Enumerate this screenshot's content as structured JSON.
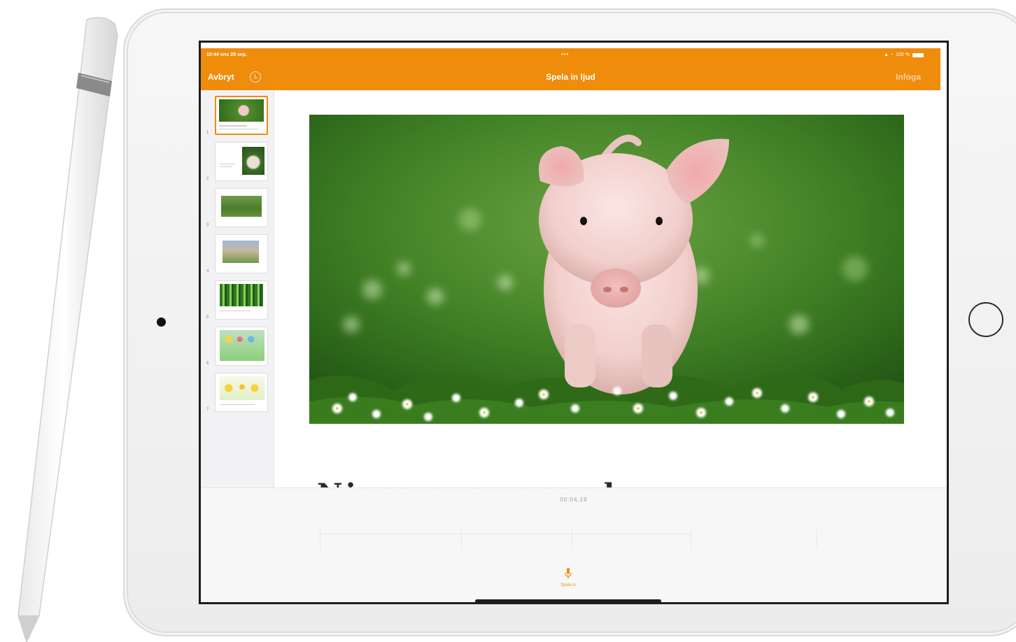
{
  "status_bar": {
    "time": "10:44  ons 29 sep.",
    "dots": "•••",
    "battery": "100 %"
  },
  "nav": {
    "cancel_label": "Avbryt",
    "title": "Spela in ljud",
    "insert_label": "Infoga"
  },
  "slides": {
    "numbers": [
      "1",
      "2",
      "3",
      "4",
      "5",
      "6",
      "7"
    ],
    "selected": "1",
    "heading": "Nisse groupcord"
  },
  "recording": {
    "elapsed": "00:04,19",
    "record_label": "Spela in"
  },
  "colors": {
    "accent": "#ef8c0c"
  }
}
